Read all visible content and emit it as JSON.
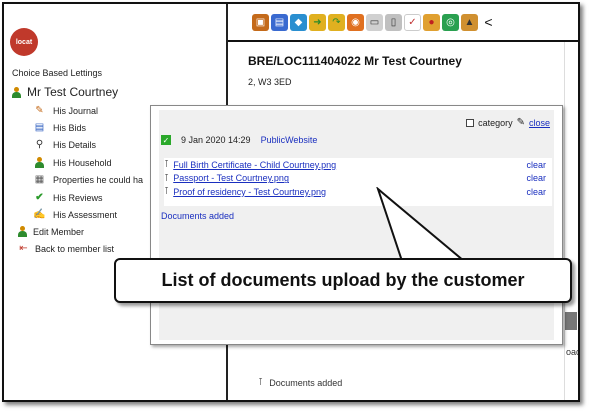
{
  "sidebar": {
    "logo_text": "locat",
    "section_title": "Choice Based Lettings",
    "member_name": "Mr Test Courtney",
    "items": [
      {
        "label": "His Journal",
        "icon": "journal-icon"
      },
      {
        "label": "His Bids",
        "icon": "bids-icon"
      },
      {
        "label": "His Details",
        "icon": "search-icon"
      },
      {
        "label": "His Household",
        "icon": "household-icon"
      },
      {
        "label": "Properties he could ha",
        "icon": "properties-icon"
      },
      {
        "label": "His Reviews",
        "icon": "check-icon"
      },
      {
        "label": "His Assessment",
        "icon": "assessment-icon"
      }
    ],
    "actions": [
      {
        "label": "Edit Member",
        "icon": "person-icon"
      },
      {
        "label": "Back to member list",
        "icon": "back-arrow-icon"
      }
    ]
  },
  "main": {
    "reference_title": "BRE/LOC111404022 Mr Test Courtney",
    "address_partial": "2, W3 3ED",
    "partial_text_right": "oad",
    "bottom_docs_added": "Documents added"
  },
  "popup": {
    "category_label": "category",
    "close_label": "close",
    "date": "9 Jan 2020 14:29",
    "source": "PublicWebsite",
    "documents": [
      {
        "name": "Full Birth Certificate - Child Courtney.png",
        "action": "clear"
      },
      {
        "name": "Passport - Test Courtney.png",
        "action": "clear"
      },
      {
        "name": "Proof of residency - Test Courtney.png",
        "action": "clear"
      }
    ],
    "status": "Documents added"
  },
  "callout": {
    "text": "List of documents upload by the customer"
  },
  "colors": {
    "link": "#1a2fbf",
    "check_green": "#2aa82a",
    "logo_red": "#c0392b"
  }
}
